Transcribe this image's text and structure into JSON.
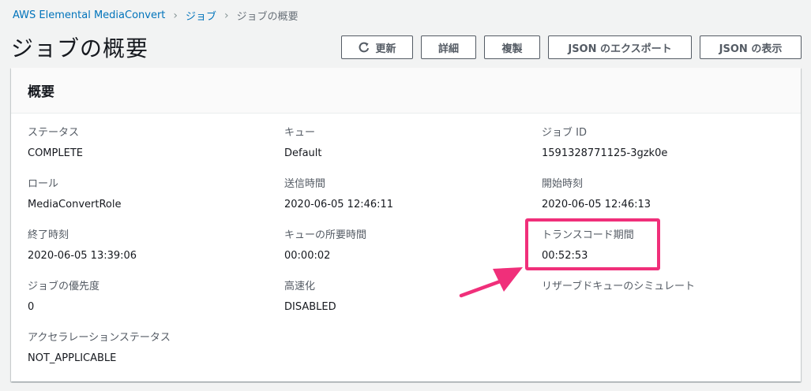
{
  "breadcrumb": {
    "items": [
      "AWS Elemental MediaConvert",
      "ジョブ"
    ],
    "current": "ジョブの概要"
  },
  "page": {
    "title": "ジョブの概要"
  },
  "toolbar": {
    "refresh_label": "更新",
    "details_label": "詳細",
    "duplicate_label": "複製",
    "export_json_label": "JSON のエクスポート",
    "view_json_label": "JSON の表示"
  },
  "summary": {
    "title": "概要",
    "fields": {
      "status": {
        "label": "ステータス",
        "value": "COMPLETE"
      },
      "queue": {
        "label": "キュー",
        "value": "Default"
      },
      "job_id": {
        "label": "ジョブ ID",
        "value": "1591328771125-3gzk0e"
      },
      "role": {
        "label": "ロール",
        "value": "MediaConvertRole"
      },
      "submit_time": {
        "label": "送信時間",
        "value": "2020-06-05 12:46:11"
      },
      "start_time": {
        "label": "開始時刻",
        "value": "2020-06-05 12:46:13"
      },
      "finish_time": {
        "label": "終了時刻",
        "value": "2020-06-05 13:39:06"
      },
      "queue_duration": {
        "label": "キューの所要時間",
        "value": "00:00:02"
      },
      "transcode_duration": {
        "label": "トランスコード期間",
        "value": "00:52:53"
      },
      "priority": {
        "label": "ジョブの優先度",
        "value": "0"
      },
      "acceleration": {
        "label": "高速化",
        "value": "DISABLED"
      },
      "reserved_queue_simulation": {
        "label": "リザーブドキューのシミュレート",
        "value": ""
      },
      "acceleration_status": {
        "label": "アクセラレーションステータス",
        "value": "NOT_APPLICABLE"
      }
    }
  },
  "annotation": {
    "color": "#f02f7a"
  },
  "icons": {
    "refresh": "refresh-icon",
    "breadcrumb_separator": "chevron-right-icon"
  },
  "colors": {
    "link": "#0073bb",
    "background": "#f2f3f3",
    "panel_header": "#fafafa"
  }
}
